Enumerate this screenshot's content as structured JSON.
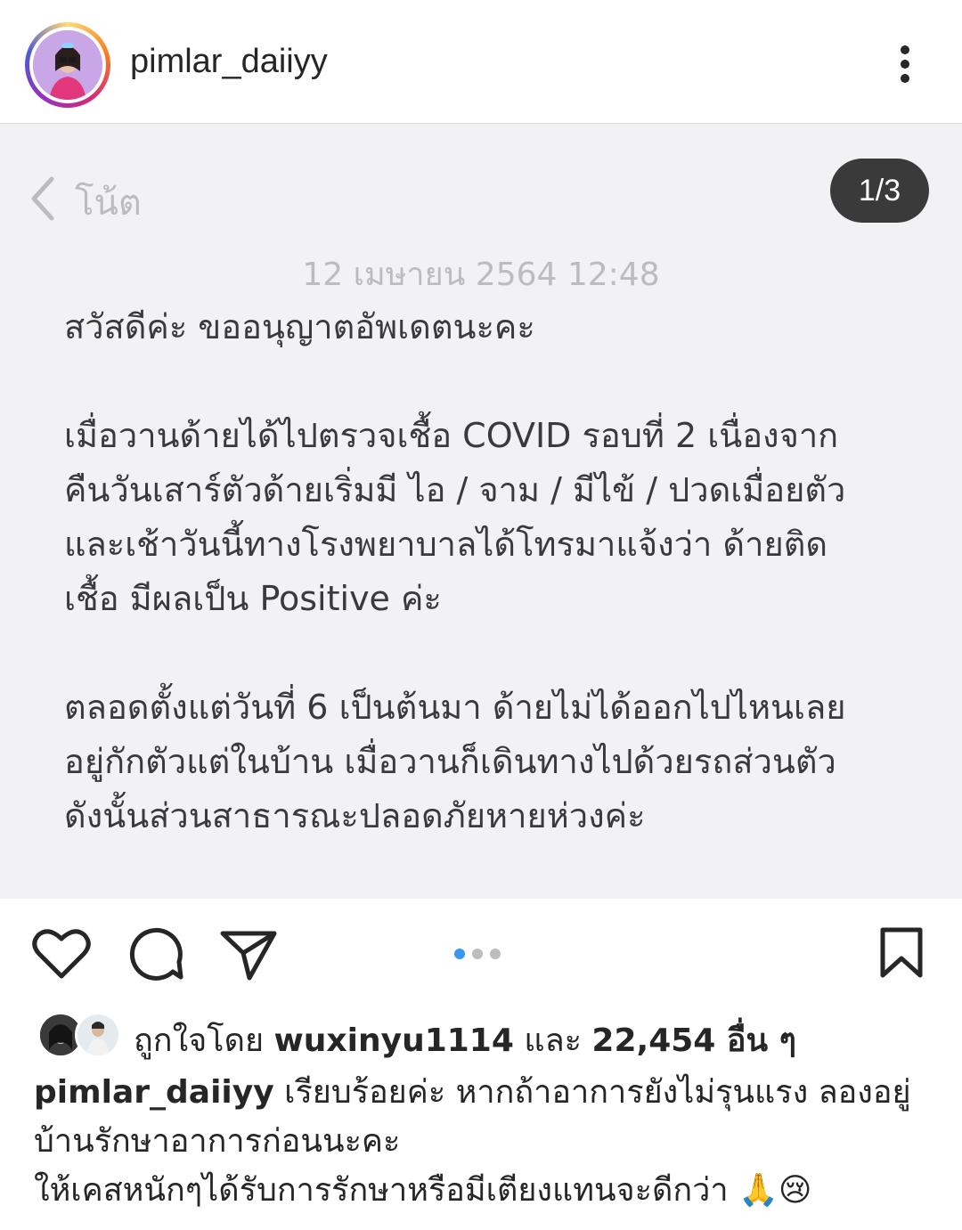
{
  "header": {
    "username": "pimlar_daiiyy",
    "more_icon": "more-vertical-icon"
  },
  "note": {
    "back_label": "โน้ต",
    "page_indicator": "1/3",
    "date": "12 เมษายน 2564 12:48",
    "paragraphs": [
      "สวัสดีค่ะ ขออนุญาตอัพเดตนะคะ",
      "เมื่อวานด้ายได้ไปตรวจเชื้อ COVID รอบที่ 2 เนื่องจาก\nคืนวันเสาร์ตัวด้ายเริ่มมี ไอ / จาม / มีไข้ / ปวดเมื่อยตัว\nและเช้าวันนี้ทางโรงพยาบาลได้โทรมาแจ้งว่า ด้ายติด\nเชื้อ มีผลเป็น Positive ค่ะ",
      "ตลอดตั้งแต่วันที่ 6 เป็นต้นมา ด้ายไม่ได้ออกไปไหนเลย\nอยู่กักตัวแต่ในบ้าน เมื่อวานก็เดินทางไปด้วยรถส่วนตัว\nดังนั้นส่วนสาธารณะปลอดภัยหายห่วงค่ะ"
    ]
  },
  "actions": {
    "icons": [
      "heart-icon",
      "comment-icon",
      "share-icon",
      "bookmark-icon"
    ],
    "carousel_active_index": 0,
    "carousel_count": 3,
    "accent_color": "#3897f0"
  },
  "likes": {
    "prefix": "ถูกใจโดย",
    "user": "wuxinyu1114",
    "conjunction": "และ",
    "count": "22,454 อื่น ๆ"
  },
  "caption": {
    "username": "pimlar_daiiyy",
    "line1": "เรียบร้อยค่ะ หากถ้าอาการยังไม่รุนแรง ลองอยู่",
    "line2": "บ้านรักษาอาการก่อนนะคะ",
    "line3": "ให้เคสหนักๆได้รับการรักษาหรือมีเตียงแทนจะดีกว่า",
    "emoji": "🙏😢"
  }
}
